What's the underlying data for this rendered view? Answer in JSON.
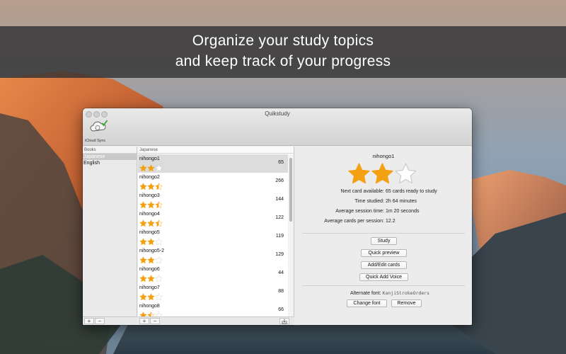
{
  "banner": {
    "line1": "Organize your study topics",
    "line2": "and keep track of your progress"
  },
  "window": {
    "title": "Quikstudy",
    "toolbar": {
      "sync_label": "iCloud Sync",
      "sync_icon": "cloud-check-icon"
    }
  },
  "books": {
    "header": "Books",
    "items": [
      {
        "label": "Japanese",
        "selected": true
      },
      {
        "label": "English",
        "selected": false
      }
    ],
    "add_label": "+",
    "remove_label": "−"
  },
  "cards": {
    "header": "Japanese",
    "rows": [
      {
        "name": "nihongo1",
        "count": "65",
        "stars": 2,
        "selected": true
      },
      {
        "name": "nihongo2",
        "count": "266",
        "stars": 2.5,
        "selected": false
      },
      {
        "name": "nihongo3",
        "count": "144",
        "stars": 2.5,
        "selected": false
      },
      {
        "name": "nihongo4",
        "count": "122",
        "stars": 2.5,
        "selected": false
      },
      {
        "name": "nihongo5",
        "count": "119",
        "stars": 2,
        "selected": false
      },
      {
        "name": "nihongo5-2",
        "count": "129",
        "stars": 2,
        "selected": false
      },
      {
        "name": "nihongo6",
        "count": "44",
        "stars": 2,
        "selected": false
      },
      {
        "name": "nihongo7",
        "count": "88",
        "stars": 2,
        "selected": false
      },
      {
        "name": "nihongo8",
        "count": "66",
        "stars": 1.5,
        "selected": false
      }
    ],
    "add_label": "+",
    "remove_label": "−",
    "export_icon": "export-icon"
  },
  "detail": {
    "title": "nihongo1",
    "rating": 2,
    "rating_max": 3,
    "next_card_label": "Next card available:",
    "next_card_value": "65 cards ready to study",
    "time_label": "Time studied:",
    "time_value": "2h 64 minutes",
    "avg_session_label": "Average session time:",
    "avg_session_value": "1m 20 seconds",
    "avg_cards_label": "Average cards per session:",
    "avg_cards_value": "12.2",
    "buttons": {
      "study": "Study",
      "quick_preview": "Quick preview",
      "add_edit": "Add/Edit cards",
      "quick_voice": "Quick Add Voice",
      "change_font": "Change font",
      "remove": "Remove"
    },
    "alt_font_label": "Alternate font:",
    "alt_font_value": "KanjiStrokeOrders"
  },
  "colors": {
    "star": "#f3a012",
    "star_empty": "#cfcfcf",
    "selection": "#dcdcdc"
  }
}
